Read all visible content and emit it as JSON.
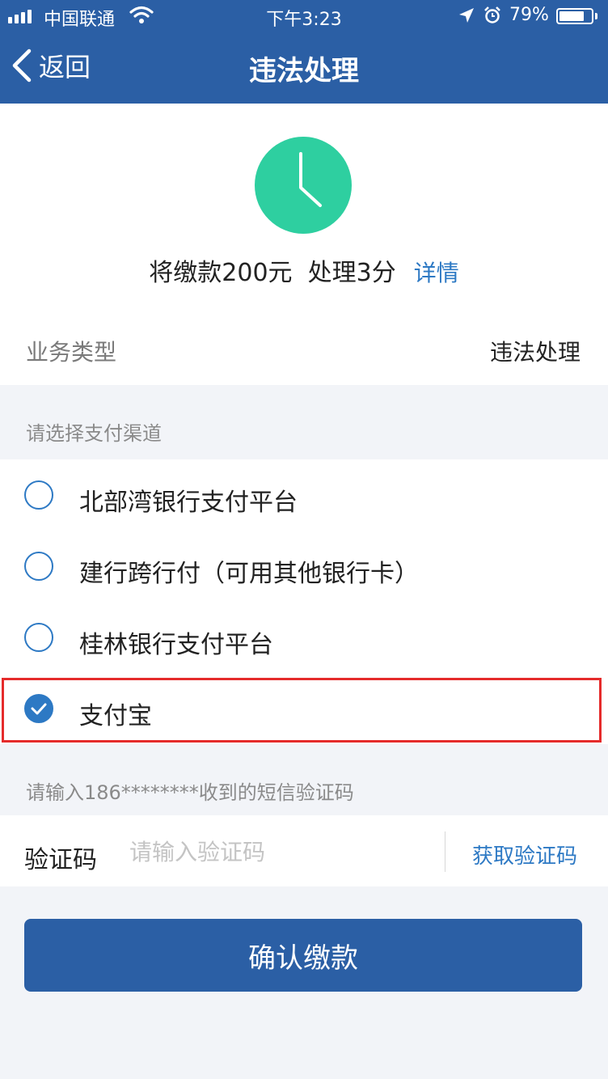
{
  "status_bar": {
    "carrier": "中国联通",
    "time": "下午3:23",
    "battery": "79%",
    "battery_level": 0.79
  },
  "nav": {
    "back_label": "返回",
    "title": "违法处理"
  },
  "summary": {
    "amount_text": "将缴款200元  处理3分",
    "details_link": "详情"
  },
  "business": {
    "label": "业务类型",
    "value": "违法处理"
  },
  "payment": {
    "header": "请选择支付渠道",
    "options": [
      {
        "label": "北部湾银行支付平台",
        "selected": false
      },
      {
        "label": "建行跨行付（可用其他银行卡）",
        "selected": false
      },
      {
        "label": "桂林银行支付平台",
        "selected": false
      },
      {
        "label": "支付宝",
        "selected": true
      }
    ]
  },
  "sms": {
    "hint": "请输入186********收到的短信验证码",
    "code_label": "验证码",
    "code_placeholder": "请输入验证码",
    "get_code": "获取验证码"
  },
  "confirm_button": "确认缴款",
  "colors": {
    "header_blue": "#2b5fa5",
    "accent_blue": "#2d79c4",
    "clock_green": "#2ecfa0",
    "highlight_red": "#e52b2b"
  },
  "icons": [
    "signal-icon",
    "wifi-icon",
    "location-icon",
    "alarm-icon",
    "battery-icon",
    "back-chevron-icon",
    "clock-icon",
    "radio-icon",
    "check-icon"
  ]
}
